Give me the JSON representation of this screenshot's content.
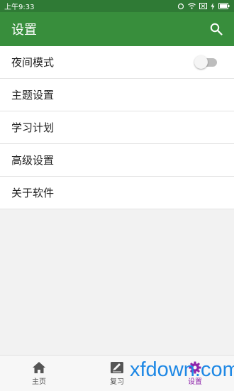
{
  "status_bar": {
    "time": "上午9:33"
  },
  "app_bar": {
    "title": "设置"
  },
  "settings": [
    {
      "label": "夜间模式"
    },
    {
      "label": "主题设置"
    },
    {
      "label": "学习计划"
    },
    {
      "label": "高级设置"
    },
    {
      "label": "关于软件"
    }
  ],
  "night_mode": {
    "enabled": false
  },
  "tabs": [
    {
      "label": "主页",
      "icon": "home-icon"
    },
    {
      "label": "复习",
      "icon": "edit-icon"
    },
    {
      "label": "设置",
      "icon": "gear-icon",
      "active": true
    }
  ],
  "watermark": "xfdown.com",
  "colors": {
    "primary": "#388e3c",
    "status_bar": "#2f7a35",
    "active_tab": "#8e24aa"
  }
}
